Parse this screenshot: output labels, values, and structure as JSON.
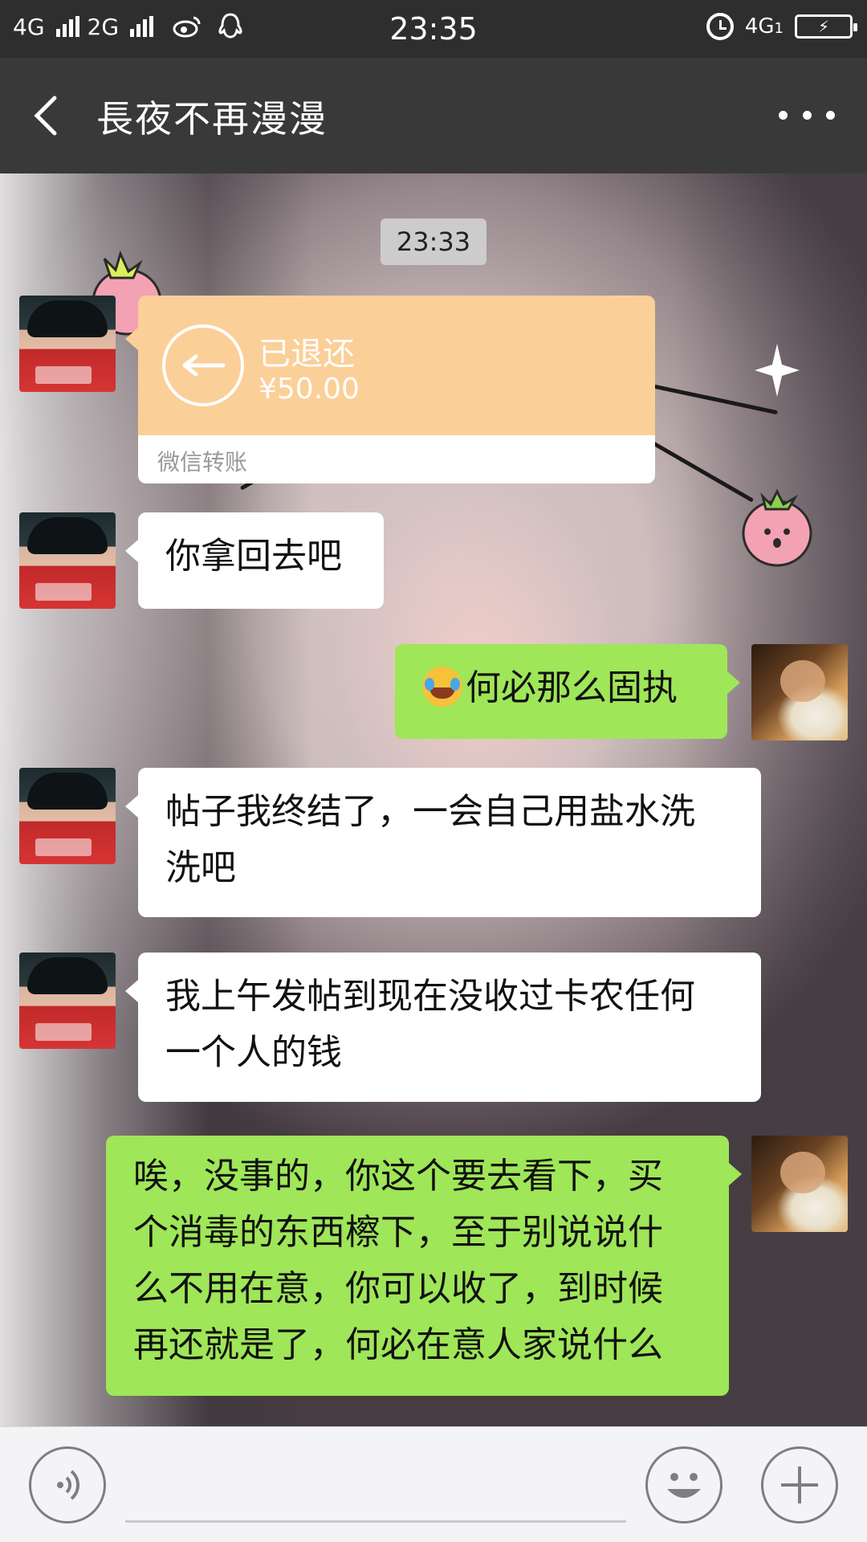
{
  "status_bar": {
    "network_1": "4G",
    "network_2": "2G",
    "time": "23:35",
    "network_right": "4G",
    "network_right_sub": "1"
  },
  "header": {
    "title": "長夜不再漫漫",
    "back_icon": "chevron-left-icon",
    "more_icon": "more-dots-icon"
  },
  "chat": {
    "timestamp": "23:33",
    "transfer": {
      "status": "已退还",
      "amount": "¥50.00",
      "label": "微信转账"
    },
    "messages": [
      {
        "side": "in",
        "text": "你拿回去吧"
      },
      {
        "side": "out",
        "emoji": "crying-laughing-emoji",
        "text": "何必那么固执"
      },
      {
        "side": "in",
        "line1": "帖子我终结了，一会自己用盐水洗",
        "line2": "洗吧"
      },
      {
        "side": "in",
        "line1": "我上午发帖到现在没收过卡农任何",
        "line2": "一个人的钱"
      },
      {
        "side": "out",
        "line1": "唉，没事的，你这个要去看下，买",
        "line2": "个消毒的东西檫下，至于别说说什",
        "line3": "么不用在意，你可以收了，到时候",
        "line4": "再还就是了，何必在意人家说什么"
      }
    ]
  },
  "input_bar": {
    "voice_icon": "voice-icon",
    "emoji_icon": "emoji-icon",
    "plus_icon": "plus-icon"
  },
  "colors": {
    "outgoing_bubble": "#9fe658",
    "incoming_bubble": "#ffffff",
    "transfer_card": "#fbcf98",
    "header": "#393939"
  }
}
